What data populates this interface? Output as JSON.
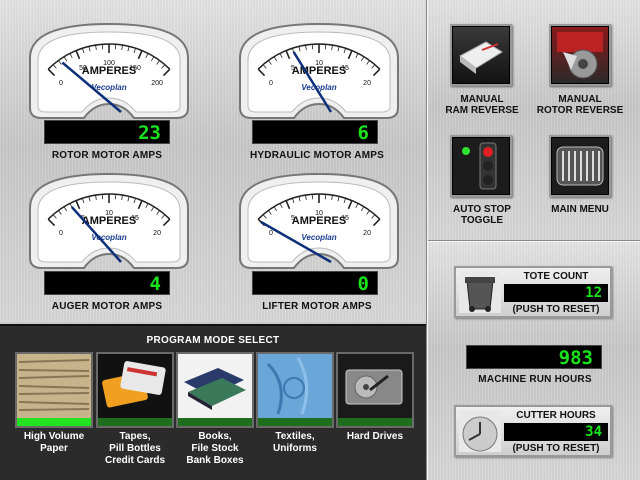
{
  "colors": {
    "readout_bg": "#000000",
    "readout_text": "#19e419",
    "mode_bar_active": "#22e222",
    "mode_bar_inactive": "#1e6e1e",
    "gauge_needle": "#0d2f7a",
    "panel_dark": "#2b2b2b"
  },
  "gauges": [
    {
      "unit_label": "AMPERES",
      "scale": [
        "0",
        "50",
        "100",
        "150",
        "200"
      ],
      "scale_max": 200,
      "needle_value": 23,
      "brand": "Vecoplan",
      "readout": "23",
      "caption": "ROTOR MOTOR AMPS"
    },
    {
      "unit_label": "AMPERES",
      "scale": [
        "0",
        "5",
        "10",
        "15",
        "20"
      ],
      "scale_max": 20,
      "needle_value": 6,
      "brand": "Vecoplan",
      "readout": "6",
      "caption": "HYDRAULIC MOTOR AMPS"
    },
    {
      "unit_label": "AMPERES",
      "scale": [
        "0",
        "5",
        "10",
        "15",
        "20"
      ],
      "scale_max": 20,
      "needle_value": 4,
      "brand": "Vecoplan",
      "readout": "4",
      "caption": "AUGER MOTOR AMPS"
    },
    {
      "unit_label": "AMPERES",
      "scale": [
        "0",
        "5",
        "10",
        "15",
        "20"
      ],
      "scale_max": 20,
      "needle_value": 0,
      "brand": "Vecoplan",
      "readout": "0",
      "caption": "LIFTER MOTOR AMPS"
    }
  ],
  "controls": {
    "manual_ram_reverse": [
      "MANUAL",
      "RAM REVERSE"
    ],
    "manual_rotor_reverse": [
      "MANUAL",
      "ROTOR REVERSE"
    ],
    "auto_stop_toggle": [
      "AUTO STOP",
      "TOGGLE"
    ],
    "main_menu": [
      "MAIN MENU"
    ]
  },
  "counters": {
    "tote_count": {
      "title": "TOTE COUNT",
      "value": "12",
      "sub": "(PUSH TO RESET)",
      "icon": "tote-bin-icon"
    },
    "machine_run_hours": {
      "value": "983",
      "caption": "MACHINE RUN HOURS"
    },
    "cutter_hours": {
      "title": "CUTTER HOURS",
      "value": "34",
      "sub": "(PUSH TO RESET)",
      "icon": "clock-icon"
    }
  },
  "program_mode": {
    "title": "PROGRAM MODE SELECT",
    "modes": [
      {
        "lines": [
          "High Volume",
          "Paper"
        ],
        "icon": "paper-stack-icon",
        "active": true
      },
      {
        "lines": [
          "Tapes,",
          "Pill Bottles",
          "Credit Cards"
        ],
        "icon": "credit-card-icon",
        "active": false
      },
      {
        "lines": [
          "Books,",
          "File Stock",
          "Bank Boxes"
        ],
        "icon": "books-icon",
        "active": false
      },
      {
        "lines": [
          "Textiles,",
          "Uniforms"
        ],
        "icon": "textile-icon",
        "active": false
      },
      {
        "lines": [
          "Hard Drives"
        ],
        "icon": "hard-drive-icon",
        "active": false
      }
    ]
  }
}
